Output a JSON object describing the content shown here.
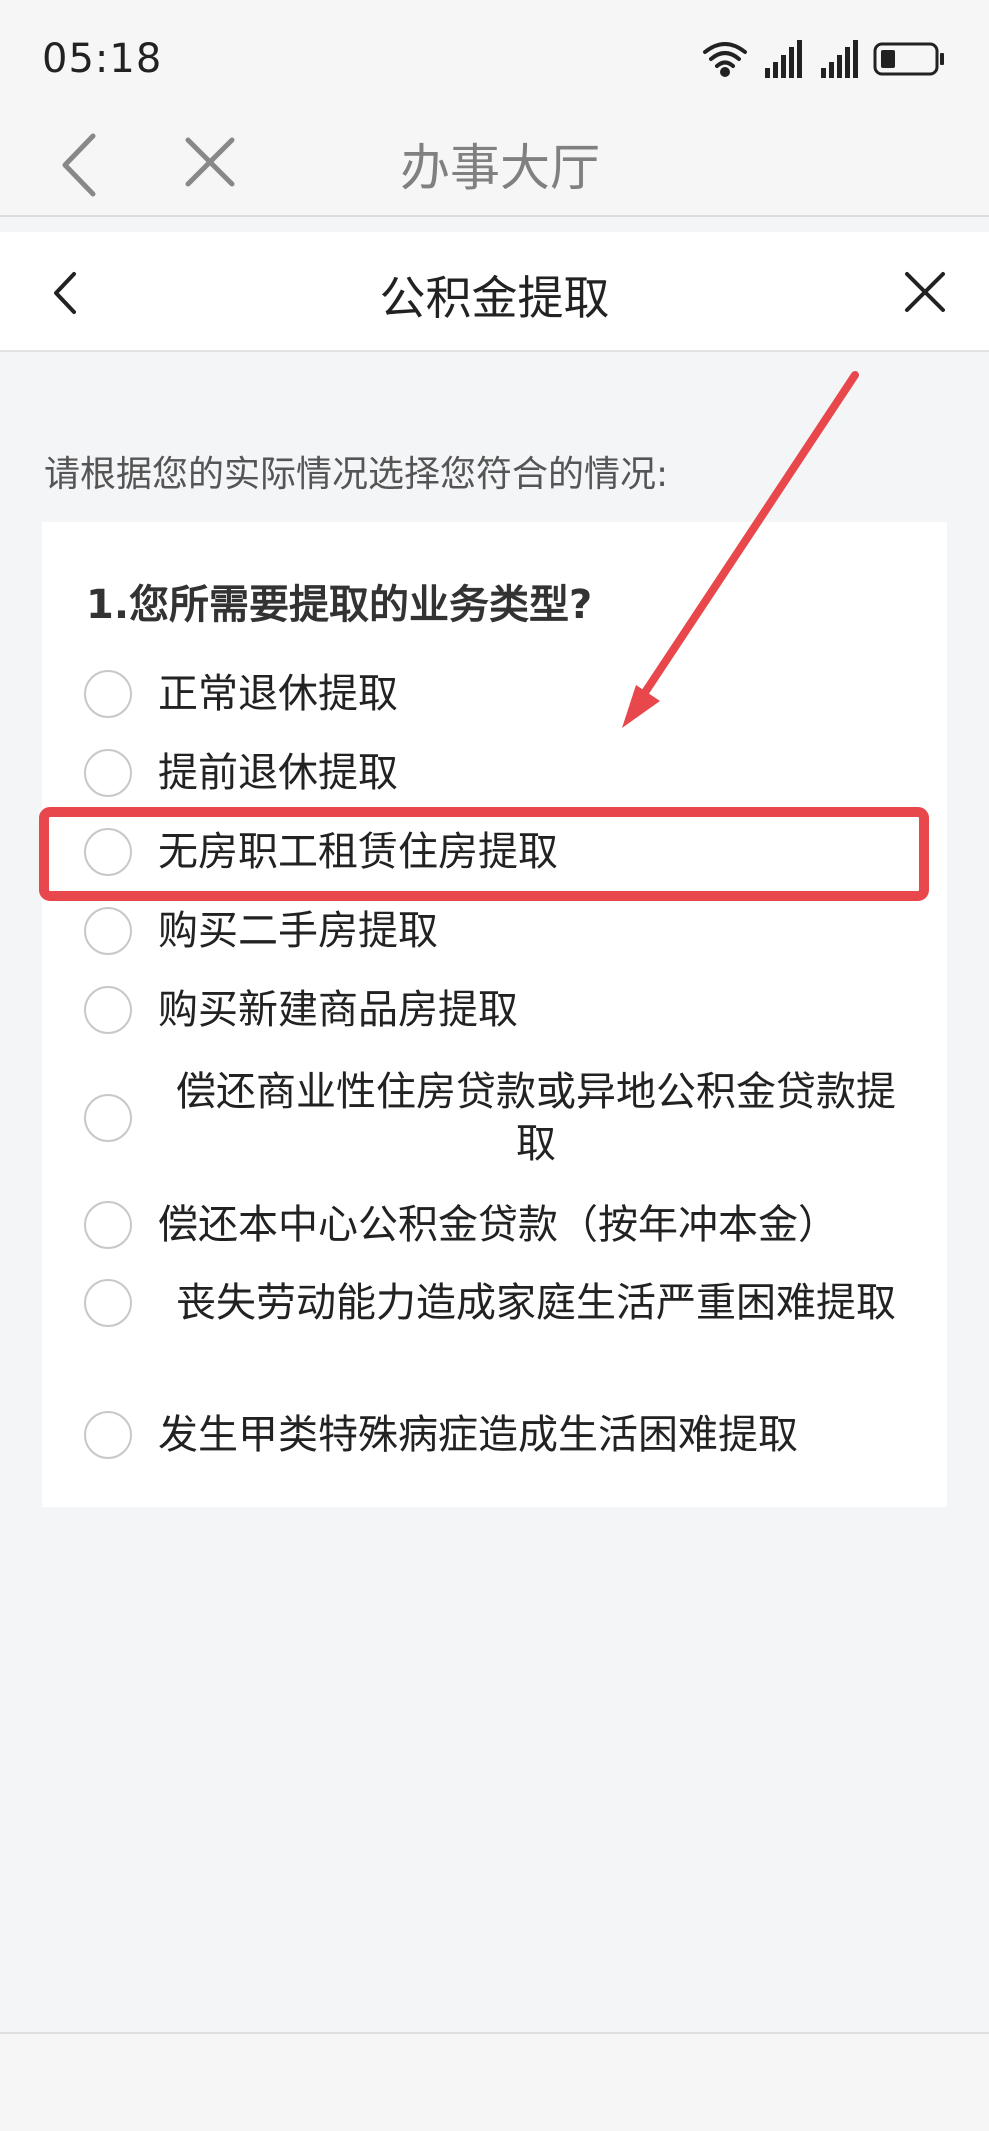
{
  "status_bar": {
    "time": "05:18"
  },
  "browser": {
    "title": "办事大厅",
    "back_icon": "chevron-left-icon",
    "close_icon": "close-icon"
  },
  "header": {
    "title": "公积金提取",
    "back_icon": "chevron-left-icon",
    "close_icon": "close-icon"
  },
  "form": {
    "instruction": "请根据您的实际情况选择您符合的情况:",
    "question": "1.您所需要提取的业务类型?",
    "options": [
      {
        "label": "正常退休提取"
      },
      {
        "label": "提前退休提取"
      },
      {
        "label": "无房职工租赁住房提取"
      },
      {
        "label": "购买二手房提取"
      },
      {
        "label": "购买新建商品房提取"
      },
      {
        "label": "偿还商业性住房贷款或异地公积金贷款提取"
      },
      {
        "label": "偿还本中心公积金贷款（按年冲本金）"
      },
      {
        "label": "丧失劳动能力造成家庭生活严重困难提取"
      },
      {
        "label": "发生甲类特殊病症造成生活困难提取"
      }
    ]
  },
  "annotation": {
    "color": "#e8474b",
    "highlighted_option": "无房职工租赁住房提取"
  }
}
